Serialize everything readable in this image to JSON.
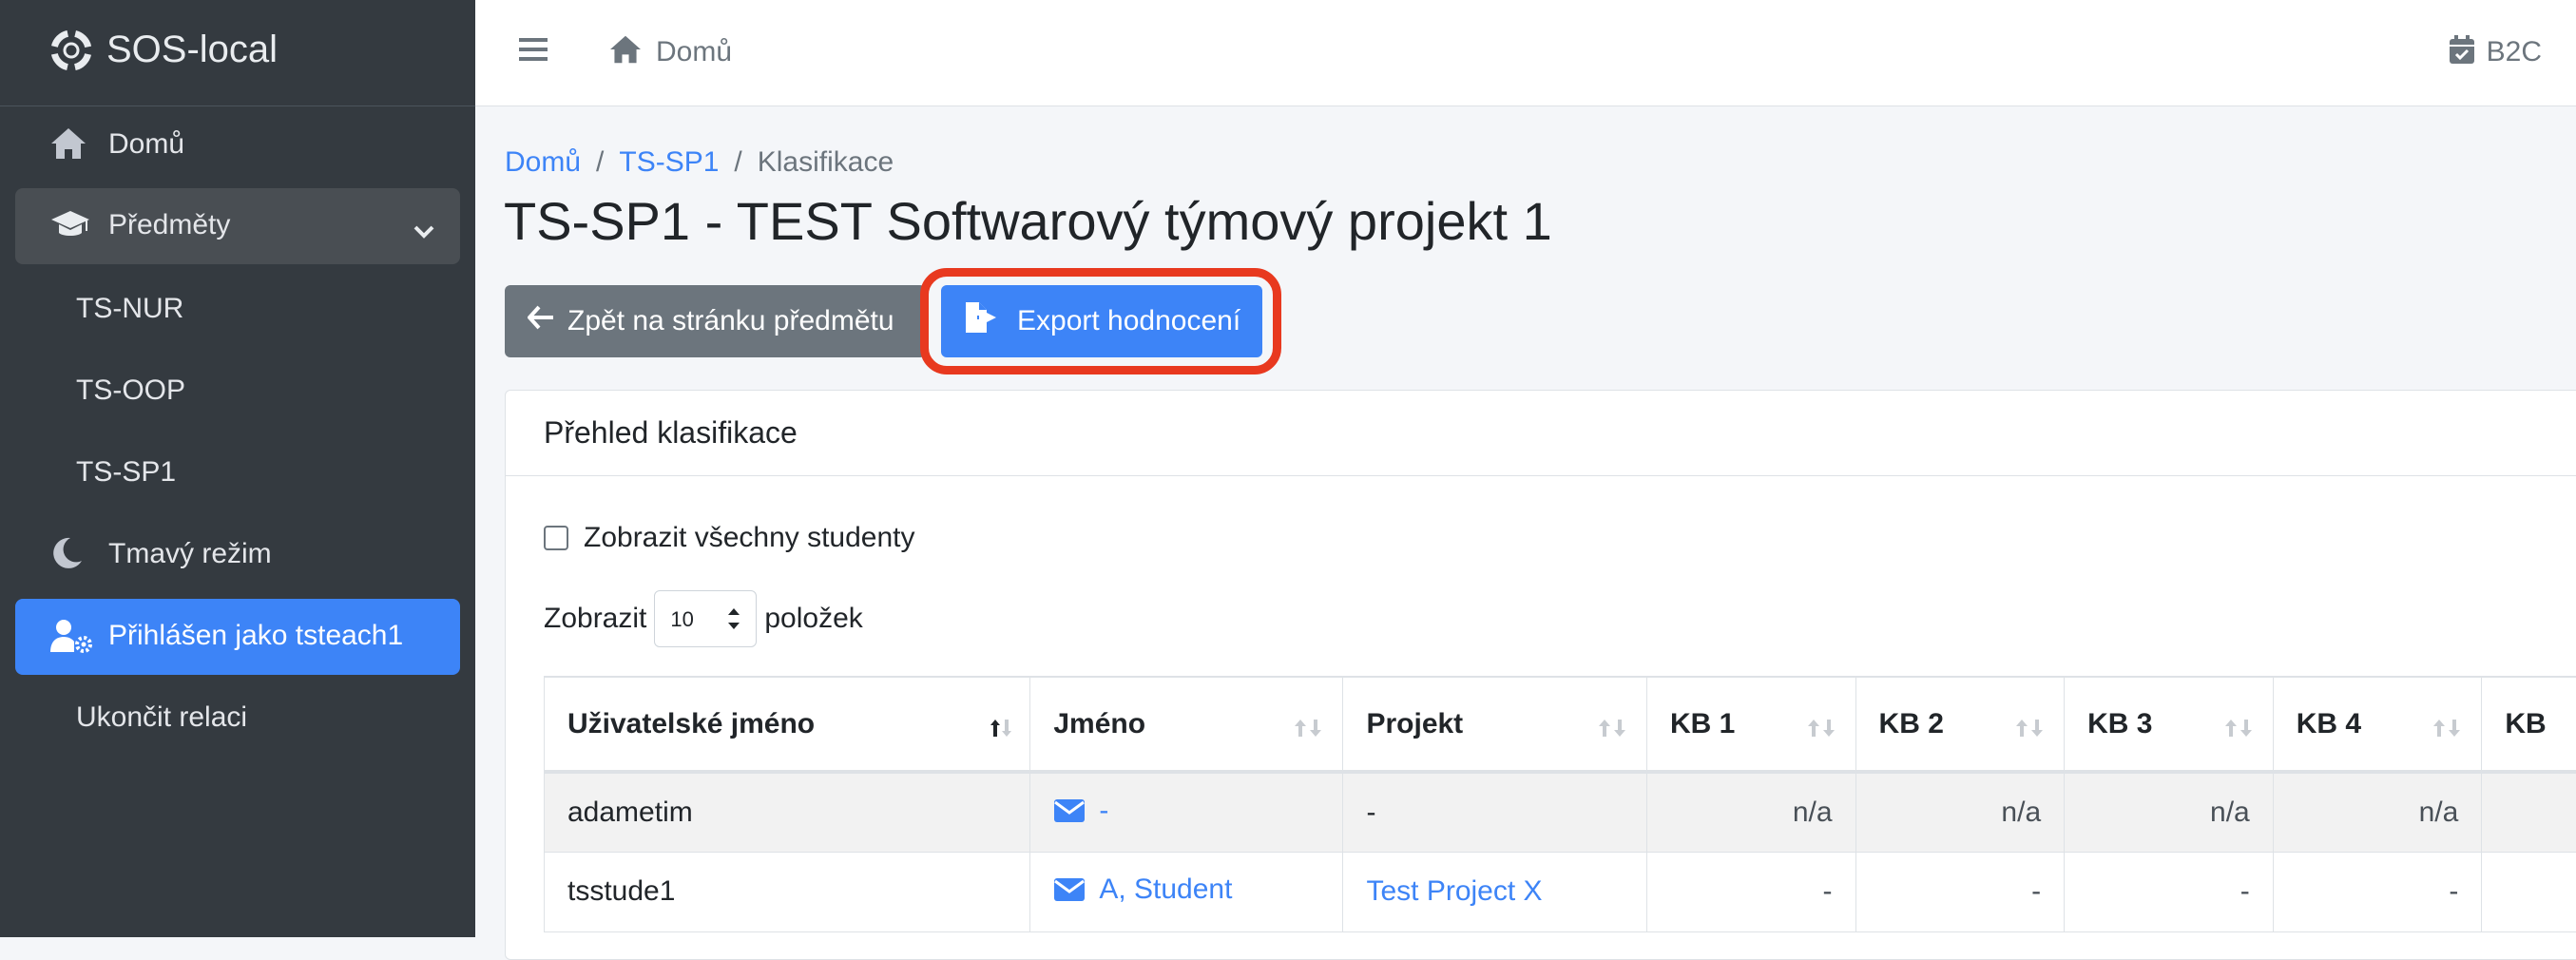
{
  "sidebar": {
    "brand": "SOS-local",
    "items": [
      {
        "label": "Domů",
        "icon": "home-icon"
      },
      {
        "label": "Předměty",
        "icon": "graduation-cap-icon"
      },
      {
        "label": "TS-NUR"
      },
      {
        "label": "TS-OOP"
      },
      {
        "label": "TS-SP1"
      },
      {
        "label": "Tmavý režim",
        "icon": "moon-icon"
      },
      {
        "label": "Přihlášen jako tsteach1",
        "icon": "user-gear-icon"
      },
      {
        "label": "Ukončit relaci"
      }
    ]
  },
  "topbar": {
    "home": "Domů",
    "right_text": "B2C"
  },
  "breadcrumb": {
    "items": [
      "Domů",
      "TS-SP1"
    ],
    "current": "Klasifikace",
    "separator": "/"
  },
  "page": {
    "title": "TS-SP1 - TEST Softwarový týmový projekt 1"
  },
  "buttons": {
    "back": "Zpět na stránku předmětu",
    "export": "Export hodnocení"
  },
  "card": {
    "title": "Přehled klasifikace",
    "show_all": "Zobrazit všechny studenty",
    "length_prefix": "Zobrazit",
    "length_value": "10",
    "length_suffix": "položek"
  },
  "table": {
    "headers": [
      "Uživatelské jméno",
      "Jméno",
      "Projekt",
      "KB 1",
      "KB 2",
      "KB 3",
      "KB 4",
      "KB"
    ],
    "rows": [
      {
        "username": "adametim",
        "name": "-",
        "project": "-",
        "kb": [
          "n/a",
          "n/a",
          "n/a",
          "n/a",
          ""
        ]
      },
      {
        "username": "tsstude1",
        "name": "A, Student",
        "project": "Test Project X",
        "kb": [
          "-",
          "-",
          "-",
          "-",
          ""
        ]
      }
    ]
  },
  "colors": {
    "sidebar_bg": "#343a40",
    "accent": "#3d84f7",
    "highlight_ring": "#e8391f"
  }
}
